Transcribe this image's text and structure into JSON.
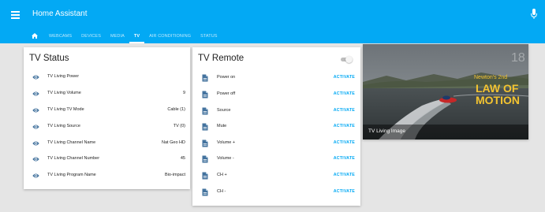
{
  "app": {
    "title": "Home Assistant"
  },
  "toolbar": {
    "menu_icon": "menu-icon",
    "mic_icon": "microphone-icon"
  },
  "tabs": [
    {
      "label": "",
      "icon": "home-icon",
      "active": false
    },
    {
      "label": "WEBCAMS",
      "active": false
    },
    {
      "label": "DEVICES",
      "active": false
    },
    {
      "label": "MEDIA",
      "active": false
    },
    {
      "label": "TV",
      "active": true
    },
    {
      "label": "AIR CONDITIONING",
      "active": false
    },
    {
      "label": "STATUS",
      "active": false
    }
  ],
  "status_card": {
    "title": "TV Status",
    "rows": [
      {
        "label": "TV Living Power",
        "value": "",
        "icon": "eye-icon"
      },
      {
        "label": "TV Living Volume",
        "value": "9",
        "icon": "eye-icon"
      },
      {
        "label": "TV Living TV Mode",
        "value": "Cable (1)",
        "icon": "eye-icon"
      },
      {
        "label": "TV Living Source",
        "value": "TV (0)",
        "icon": "eye-icon"
      },
      {
        "label": "TV Living Channel Name",
        "value": "Nat Geo HD",
        "icon": "eye-icon"
      },
      {
        "label": "TV Living Channel Number",
        "value": "45",
        "icon": "eye-icon"
      },
      {
        "label": "TV Living Program Name",
        "value": "Bio-impact",
        "icon": "eye-icon"
      }
    ]
  },
  "remote_card": {
    "title": "TV Remote",
    "toggle_on": false,
    "rows": [
      {
        "label": "Power on",
        "action": "ACTIVATE",
        "icon": "file-document-icon"
      },
      {
        "label": "Power off",
        "action": "ACTIVATE",
        "icon": "file-document-icon"
      },
      {
        "label": "Source",
        "action": "ACTIVATE",
        "icon": "file-document-icon"
      },
      {
        "label": "Mute",
        "action": "ACTIVATE",
        "icon": "file-document-icon"
      },
      {
        "label": "Volume +",
        "action": "ACTIVATE",
        "icon": "file-document-icon"
      },
      {
        "label": "Volume -",
        "action": "ACTIVATE",
        "icon": "file-document-icon"
      },
      {
        "label": "CH +",
        "action": "ACTIVATE",
        "icon": "file-document-icon"
      },
      {
        "label": "CH -",
        "action": "ACTIVATE",
        "icon": "file-document-icon"
      }
    ]
  },
  "image_card": {
    "caption": "TV Living Image",
    "overlay_line1": "Newton's 2nd",
    "overlay_line2": "LAW OF",
    "overlay_line3": "MOTION",
    "corner_number": "18"
  },
  "colors": {
    "primary": "#03a9f4",
    "background": "#e5e5e5",
    "card": "#ffffff",
    "icon": "#44739e",
    "accent_text": "#f4c430"
  }
}
